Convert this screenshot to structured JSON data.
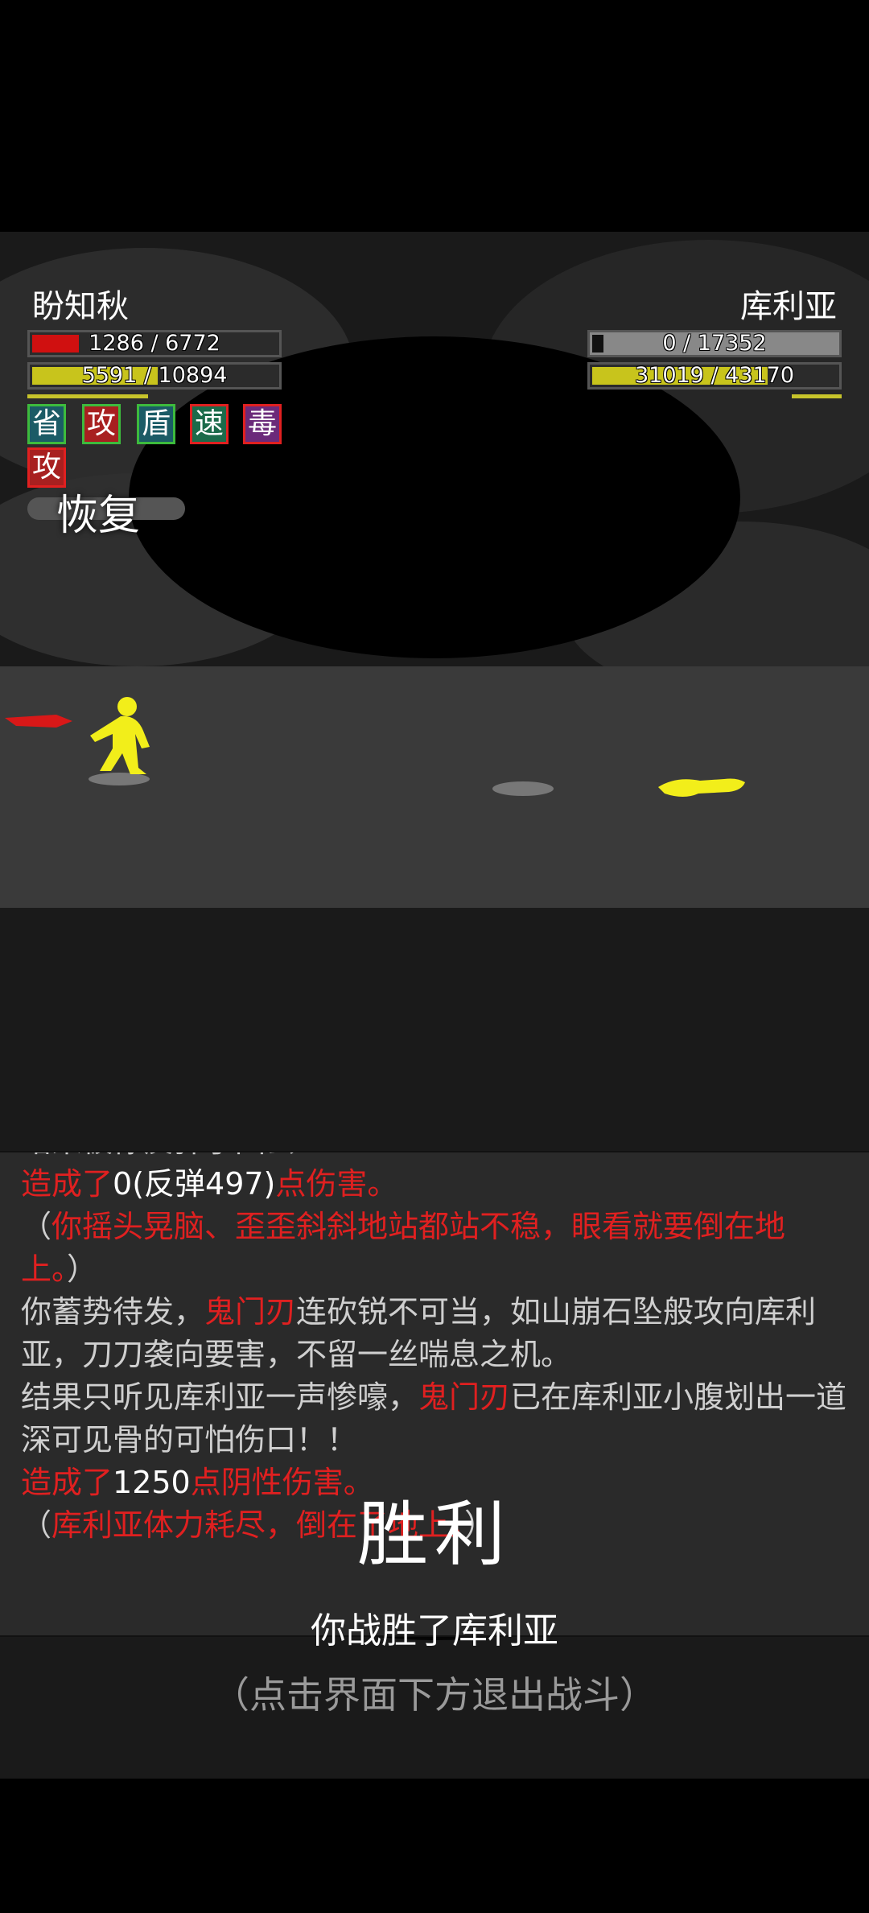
{
  "player": {
    "name": "盼知秋",
    "hp": {
      "current": 1286,
      "max": 6772,
      "text": "1286 / 6772",
      "color": "#d01010"
    },
    "energy": {
      "current": 5591,
      "max": 10894,
      "text": "5591 / 10894",
      "color": "#c8c41c"
    },
    "buffs": [
      {
        "label": "省",
        "border": "#3dbb3d",
        "bg": "#1b5b66"
      },
      {
        "label": "攻",
        "border": "#3dbb3d",
        "bg": "#a82020"
      },
      {
        "label": "盾",
        "border": "#3dbb3d",
        "bg": "#1b5b66"
      },
      {
        "label": "速",
        "border": "#e02020",
        "bg": "#1b6b4a"
      },
      {
        "label": "毒",
        "border": "#e02020",
        "bg": "#6b2a7a"
      },
      {
        "label": "攻",
        "border": "#e02020",
        "bg": "#a82020"
      }
    ],
    "status": "恢复"
  },
  "enemy": {
    "name": "库利亚",
    "hp": {
      "current": 0,
      "max": 17352,
      "text": "0 / 17352",
      "color": "#888888"
    },
    "energy": {
      "current": 31019,
      "max": 43170,
      "text": "31019 / 43170",
      "color": "#c8c41c"
    }
  },
  "log": {
    "lines": [
      [
        {
          "t": "结果被你反弹了回去！",
          "c": "gray"
        }
      ],
      [
        {
          "t": "造成了",
          "c": "red"
        },
        {
          "t": "0(反弹497)",
          "c": "white"
        },
        {
          "t": "点伤害。",
          "c": "red"
        }
      ],
      [
        {
          "t": "（",
          "c": "gray"
        },
        {
          "t": "你摇头晃脑、歪歪斜斜地站都站不稳，眼看就要倒在地上。",
          "c": "red"
        },
        {
          "t": "）",
          "c": "gray"
        }
      ],
      [
        {
          "t": "你蓄势待发，",
          "c": "gray"
        },
        {
          "t": "鬼门刃",
          "c": "red"
        },
        {
          "t": "连砍锐不可当，如山崩石坠般攻向库利亚，刀刀袭向要害，不留一丝喘息之机。",
          "c": "gray"
        }
      ],
      [
        {
          "t": "结果只听见库利亚一声惨嚎，",
          "c": "gray"
        },
        {
          "t": "鬼门刃",
          "c": "red"
        },
        {
          "t": "已在库利亚小腹划出一道深可见骨的可怕伤口！！",
          "c": "gray"
        }
      ],
      [
        {
          "t": "造成了",
          "c": "red"
        },
        {
          "t": "1250",
          "c": "white"
        },
        {
          "t": "点阴性伤害。",
          "c": "red"
        }
      ],
      [
        {
          "t": "（",
          "c": "gray"
        },
        {
          "t": "库利亚体力耗尽，倒在了地上。",
          "c": "red"
        },
        {
          "t": "）",
          "c": "gray"
        }
      ]
    ]
  },
  "result": {
    "title": "胜利",
    "subtitle": "你战胜了库利亚",
    "hint": "（点击界面下方退出战斗）"
  }
}
